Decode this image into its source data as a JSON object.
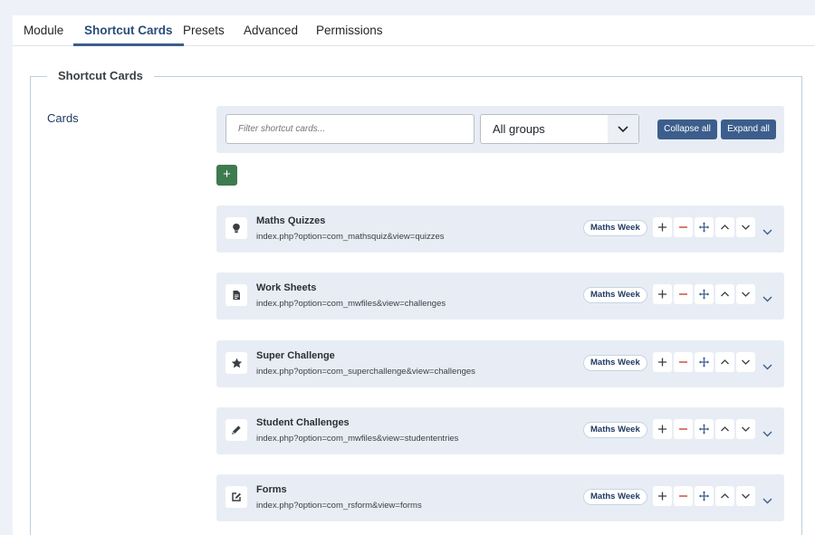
{
  "tabs": [
    "Module",
    "Shortcut Cards",
    "Presets",
    "Advanced",
    "Permissions"
  ],
  "active_tab": "Shortcut Cards",
  "section": {
    "legend": "Shortcut Cards",
    "field_label": "Cards"
  },
  "toolbar": {
    "filter_placeholder": "Filter shortcut cards...",
    "group_value": "All groups",
    "collapse_label": "Collapse all",
    "expand_label": "Expand all",
    "add_label": "+"
  },
  "cards": [
    {
      "icon": "lightbulb-icon",
      "title": "Maths Quizzes",
      "url": "index.php?option=com_mathsquiz&view=quizzes",
      "group": "Maths Week"
    },
    {
      "icon": "file-icon",
      "title": "Work Sheets",
      "url": "index.php?option=com_mwfiles&view=challenges",
      "group": "Maths Week"
    },
    {
      "icon": "star-icon",
      "title": "Super Challenge",
      "url": "index.php?option=com_superchallenge&view=challenges",
      "group": "Maths Week"
    },
    {
      "icon": "pencil-icon",
      "title": "Student Challenges",
      "url": "index.php?option=com_mwfiles&view=studententries",
      "group": "Maths Week"
    },
    {
      "icon": "edit-icon",
      "title": "Forms",
      "url": "index.php?option=com_rsform&view=forms",
      "group": "Maths Week"
    }
  ],
  "colors": {
    "accent": "#3c5e8c",
    "add_button": "#3e7b4f",
    "remove": "#c0392b",
    "card_bg": "#e8edf5"
  }
}
